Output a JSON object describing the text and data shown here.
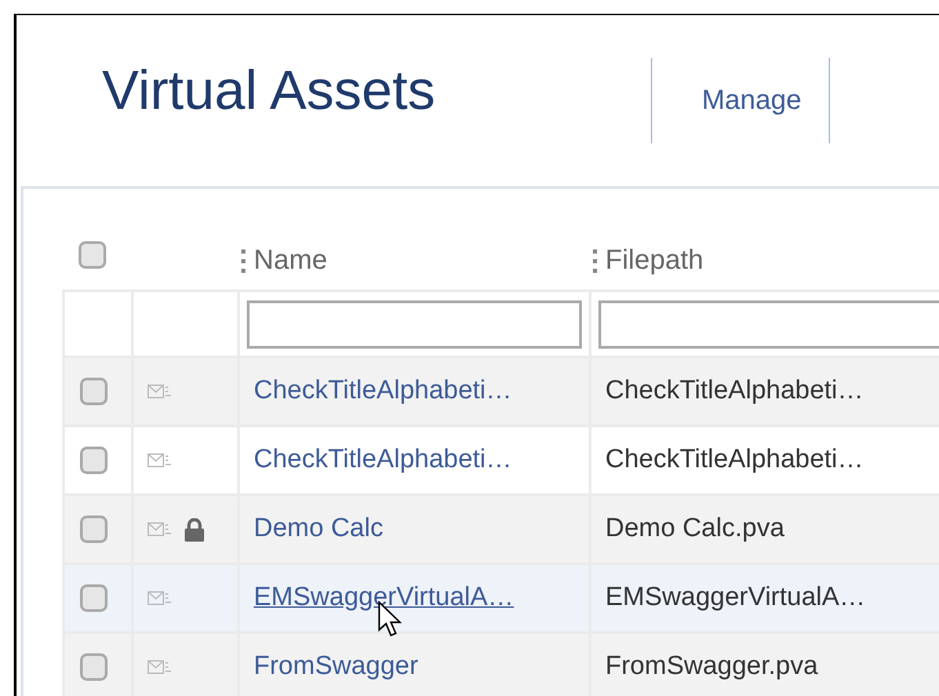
{
  "page": {
    "title": "Virtual Assets",
    "nav": [
      {
        "label": "Manage"
      }
    ]
  },
  "table": {
    "header_checked": false,
    "columns": [
      {
        "label": "Name"
      },
      {
        "label": "Filepath"
      }
    ],
    "rows": [
      {
        "checked": false,
        "locked": false,
        "hovered": false,
        "name": "CheckTitleAlphabeti…",
        "filepath": "CheckTitleAlphabeti…"
      },
      {
        "checked": false,
        "locked": false,
        "hovered": false,
        "name": "CheckTitleAlphabeti…",
        "filepath": "CheckTitleAlphabeti…"
      },
      {
        "checked": false,
        "locked": true,
        "hovered": false,
        "name": "Demo Calc",
        "filepath": "Demo Calc.pva"
      },
      {
        "checked": false,
        "locked": false,
        "hovered": true,
        "name": "EMSwaggerVirtualA…",
        "filepath": "EMSwaggerVirtualA…"
      },
      {
        "checked": false,
        "locked": false,
        "hovered": false,
        "name": "FromSwagger",
        "filepath": "FromSwagger.pva"
      }
    ]
  }
}
